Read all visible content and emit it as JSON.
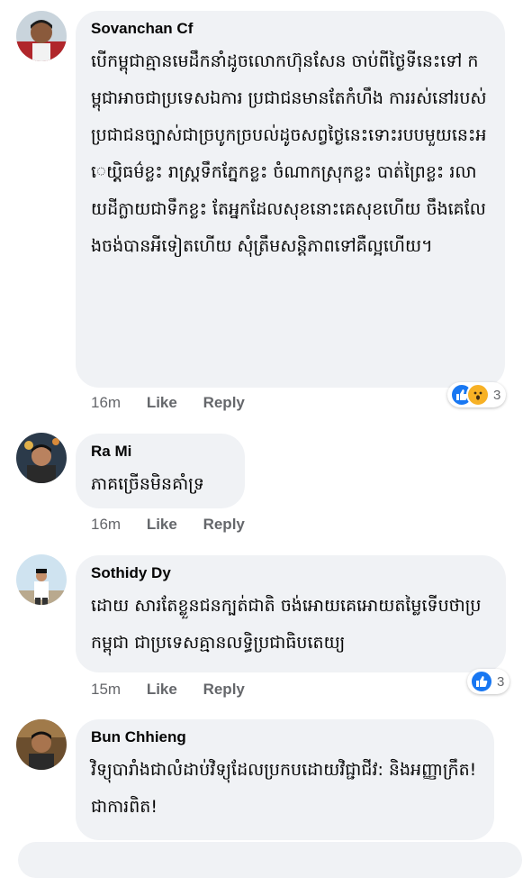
{
  "comments": [
    {
      "author": "Sovanchan Cf",
      "text": "បើកម្ពុជាគ្មានមេដឹកនាំដូចលោកហ៊ុនសែន ចាប់ពីថ្ងៃទីនេះទៅ កម្ពុជាអាចជាប្រទេសឯការ ប្រជាជនមានតែកំហឹង ការរស់នៅរបស់ប្រជាជនច្បាស់ជាច្របូកច្របល់ដូចសព្វថ្ងៃនេះទោះរបបមួយនេះអេយ្ត្តិធម៌ខ្លះ រាស្ត្រទឹកភ្នែកខ្លះ ចំណាកស្រុកខ្លះ បាត់ព្រៃខ្លះ រលាយដីក្លាយជាទឹកខ្លះ តែអ្នកដែលសុខនោះគេសុខហើយ ចឹងគេលែងចង់បានអីទៀតហើយ សុំត្រឹមសន្តិភាពទៅគឺល្អហើយ។",
      "time": "16m",
      "like_label": "Like",
      "reply_label": "Reply",
      "reaction_count": "3"
    },
    {
      "author": "Ra Mi",
      "text": "ភាគច្រើនមិនគាំទ្រ",
      "time": "16m",
      "like_label": "Like",
      "reply_label": "Reply"
    },
    {
      "author": "Sothidy Dy",
      "text": "ដោយ សារតែខ្លួនជនក្បត់ជាតិ ចង់អោយគេអោយតម្លៃទើបថាប្រកម្ពុជា ជាប្រទេសគ្មានលទ្ធិប្រជាធិបតេយ្យ",
      "time": "15m",
      "like_label": "Like",
      "reply_label": "Reply",
      "reaction_count": "3"
    },
    {
      "author": "Bun Chhieng",
      "text": "វិទ្យុបារាំងជាលំដាប់វិទ្យុដែលប្រកបដោយវិជ្ជាជីវ: និងអញ្ញាក្រឹត! ជាការពិត!"
    }
  ],
  "colors": {
    "bubble": "#f0f2f5",
    "meta": "#65676b",
    "like_blue": "#1877f2",
    "wow_yellow": "#f7b125"
  },
  "icons": [
    "like-reaction-icon",
    "wow-reaction-icon"
  ]
}
